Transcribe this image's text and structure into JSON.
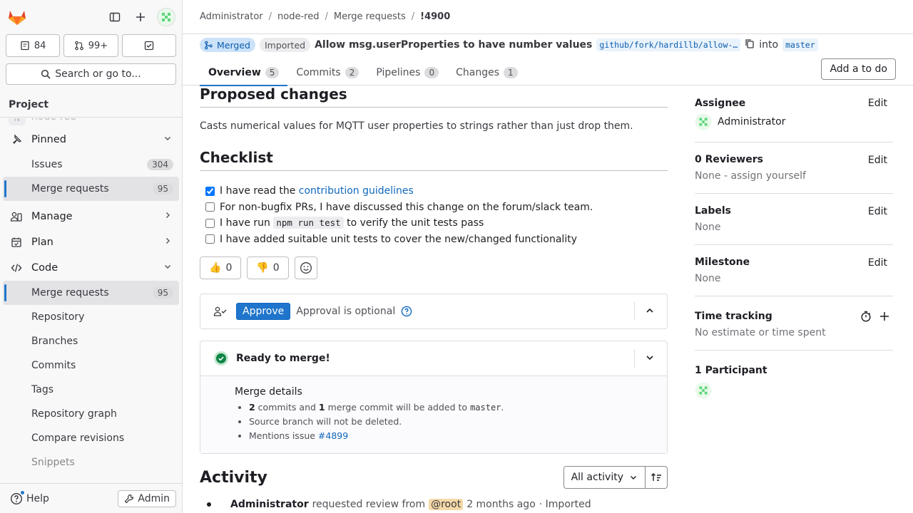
{
  "sidebar": {
    "counts": {
      "issues": "84",
      "merge_requests": "99+"
    },
    "search_label": "Search or go to...",
    "section_title": "Project",
    "project_ghost": "node-red",
    "project_ghost_initial": "N",
    "pinned": {
      "label": "Pinned",
      "items": [
        {
          "label": "Issues",
          "count": "304"
        },
        {
          "label": "Merge requests",
          "count": "95"
        }
      ]
    },
    "manage": "Manage",
    "plan": "Plan",
    "code": {
      "label": "Code",
      "items": [
        {
          "label": "Merge requests",
          "count": "95"
        },
        {
          "label": "Repository"
        },
        {
          "label": "Branches"
        },
        {
          "label": "Commits"
        },
        {
          "label": "Tags"
        },
        {
          "label": "Repository graph"
        },
        {
          "label": "Compare revisions"
        },
        {
          "label": "Snippets"
        }
      ]
    },
    "help": "Help",
    "admin": "Admin"
  },
  "breadcrumb": [
    "Administrator",
    "node-red",
    "Merge requests",
    "!4900"
  ],
  "mr": {
    "status": "Merged",
    "imported": "Imported",
    "title": "Allow msg.userProperties to have number values",
    "source_branch": "github/fork/hardillb/allow-…",
    "into": "into",
    "target_branch": "master",
    "tabs": [
      {
        "label": "Overview",
        "count": "5"
      },
      {
        "label": "Commits",
        "count": "2"
      },
      {
        "label": "Pipelines",
        "count": "0"
      },
      {
        "label": "Changes",
        "count": "1"
      }
    ],
    "todo_button": "Add a to do"
  },
  "description": {
    "proposed_heading": "Proposed changes",
    "proposed_text": "Casts numerical values for MQTT user properties to strings rather than just drop them.",
    "checklist_heading": "Checklist",
    "checklist": {
      "item1_pre": "I have read the ",
      "item1_link": "contribution guidelines",
      "item2": "For non-bugfix PRs, I have discussed this change on the forum/slack team.",
      "item3_pre": "I have run ",
      "item3_code": "npm run test",
      "item3_post": " to verify the unit tests pass",
      "item4": "I have added suitable unit tests to cover the new/changed functionality"
    }
  },
  "reactions": {
    "thumbs_up": "0",
    "thumbs_down": "0"
  },
  "approval": {
    "button": "Approve",
    "text": "Approval is optional"
  },
  "merge": {
    "ready": "Ready to merge!",
    "details_title": "Merge details",
    "line1_commits": "2",
    "line1_mid": " commits and ",
    "line1_merge": "1",
    "line1_post": " merge commit will be added to ",
    "line1_branch": "master",
    "line1_end": ".",
    "line2": "Source branch will not be deleted.",
    "line3_pre": "Mentions issue ",
    "line3_link": "#4899"
  },
  "activity": {
    "heading": "Activity",
    "filter": "All activity",
    "entry_author": "Administrator",
    "entry_action": "requested review from",
    "entry_mention": "@root",
    "entry_time": "2 months ago",
    "entry_suffix": "· Imported"
  },
  "right_sidebar": {
    "assignee_title": "Assignee",
    "assignee_name": "Administrator",
    "reviewers_title": "0 Reviewers",
    "reviewers_value": "None - assign yourself",
    "labels_title": "Labels",
    "labels_value": "None",
    "milestone_title": "Milestone",
    "milestone_value": "None",
    "time_title": "Time tracking",
    "time_value": "No estimate or time spent",
    "participants_title": "1 Participant",
    "edit": "Edit"
  },
  "colors": {
    "accent": "#1f75cb",
    "merged_bg": "#cbe2f9",
    "success": "#108548"
  }
}
